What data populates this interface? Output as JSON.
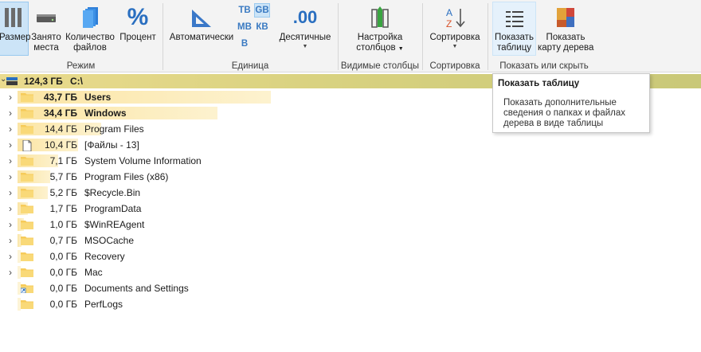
{
  "ribbon": {
    "groups": {
      "mode": "Режим",
      "unit": "Единица",
      "columns": "Видимые столбцы",
      "sort": "Сортировка",
      "show": "Показать или скрыть"
    },
    "buttons": {
      "size": "Размер",
      "allocated_1": "Занято",
      "allocated_2": "места",
      "count_1": "Количество",
      "count_2": "файлов",
      "percent": "Процент",
      "auto": "Автоматически",
      "decimals": "Десятичные",
      "decimals_icon": ".00",
      "columns_1": "Настройка",
      "columns_2": "столбцов",
      "sort": "Сортировка",
      "show_table_1": "Показать",
      "show_table_2": "таблицу",
      "treemap_1": "Показать",
      "treemap_2": "карту дерева"
    },
    "units": [
      "ТВ",
      "GB",
      "МВ",
      "КВ",
      "В"
    ],
    "selected_unit": "GB"
  },
  "tree": {
    "root": {
      "size": "124,3 ГБ",
      "name": "C:\\"
    },
    "items": [
      {
        "size": "43,7 ГБ",
        "name": "Users",
        "bold": true,
        "expandable": true,
        "icon": "folder-icon",
        "pct": 100
      },
      {
        "size": "34,4 ГБ",
        "name": "Windows",
        "bold": true,
        "expandable": true,
        "icon": "folder-icon",
        "pct": 79
      },
      {
        "size": "14,4 ГБ",
        "name": "Program Files",
        "expandable": true,
        "icon": "folder-icon",
        "pct": 33
      },
      {
        "size": "10,4 ГБ",
        "name": "[Файлы - 13]",
        "expandable": true,
        "icon": "file-icon",
        "pct": 24
      },
      {
        "size": "7,1 ГБ",
        "name": "System Volume Information",
        "expandable": true,
        "icon": "folder-icon",
        "pct": 16
      },
      {
        "size": "5,7 ГБ",
        "name": "Program Files (x86)",
        "expandable": true,
        "icon": "folder-icon",
        "pct": 13
      },
      {
        "size": "5,2 ГБ",
        "name": "$Recycle.Bin",
        "expandable": true,
        "icon": "folder-icon",
        "pct": 12
      },
      {
        "size": "1,7 ГБ",
        "name": "ProgramData",
        "expandable": true,
        "icon": "folder-icon",
        "pct": 4
      },
      {
        "size": "1,0 ГБ",
        "name": "$WinREAgent",
        "expandable": true,
        "icon": "folder-icon",
        "pct": 2.5
      },
      {
        "size": "0,7 ГБ",
        "name": "MSOCache",
        "expandable": true,
        "icon": "folder-icon",
        "pct": 1.5
      },
      {
        "size": "0,0 ГБ",
        "name": "Recovery",
        "expandable": true,
        "icon": "folder-icon",
        "pct": 0
      },
      {
        "size": "0,0 ГБ",
        "name": "Mac",
        "expandable": true,
        "icon": "folder-icon",
        "pct": 0
      },
      {
        "size": "0,0 ГБ",
        "name": "Documents and Settings",
        "expandable": false,
        "icon": "folder-shortcut-icon",
        "pct": 0
      },
      {
        "size": "0,0 ГБ",
        "name": "PerfLogs",
        "expandable": false,
        "icon": "folder-icon",
        "pct": 0
      }
    ]
  },
  "tooltip": {
    "title": "Показать таблицу",
    "body": "Показать дополнительные сведения о папках и файлах дерева в виде таблицы"
  },
  "colors": {
    "accent": "#99c9ef",
    "bar": "#fbe5a4",
    "folder": "#f6cb5a"
  }
}
